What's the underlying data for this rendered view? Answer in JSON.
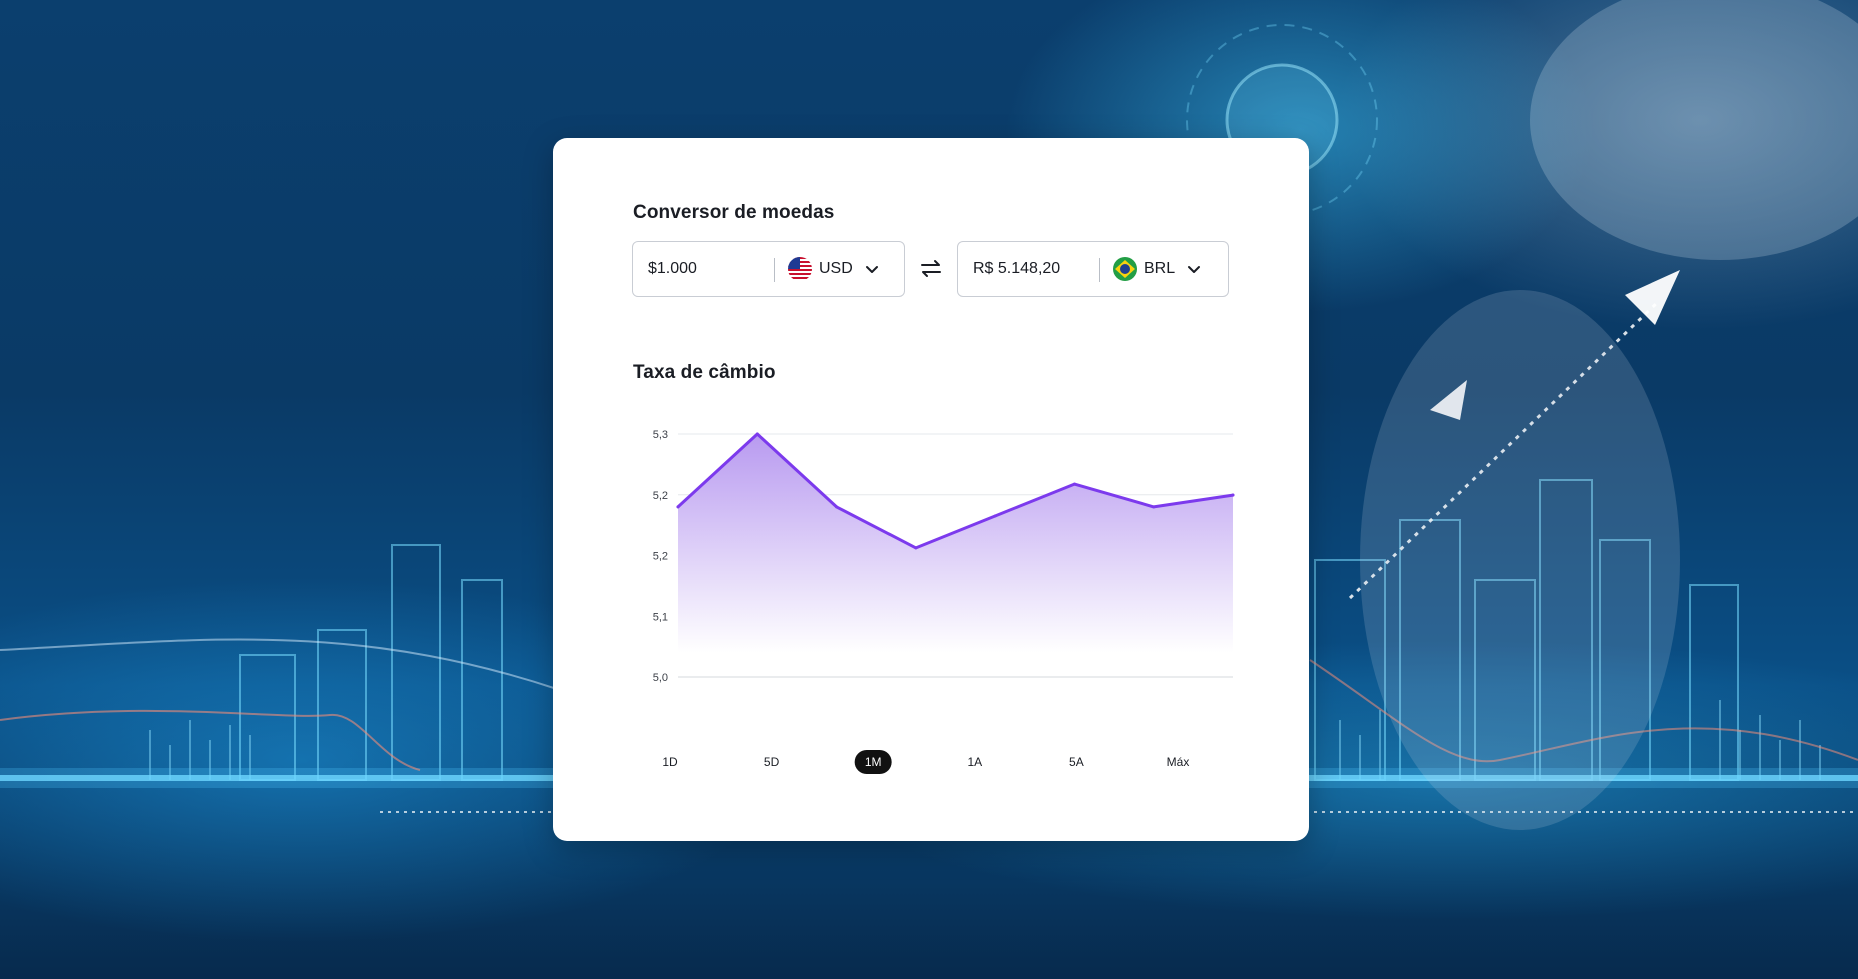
{
  "converter": {
    "title": "Conversor de moedas",
    "from": {
      "amount": "$1.000",
      "currency": "USD",
      "flag": "us-flag-icon"
    },
    "to": {
      "amount": "R$ 5.148,20",
      "currency": "BRL",
      "flag": "brazil-flag-icon"
    },
    "swap_icon": "swap-arrows-icon"
  },
  "exchange": {
    "title": "Taxa de câmbio",
    "ranges": [
      "1D",
      "5D",
      "1M",
      "1A",
      "5A",
      "Máx"
    ],
    "active_range": "1M"
  },
  "chart_data": {
    "type": "area",
    "title": "",
    "xlabel": "",
    "ylabel": "",
    "y_tick_labels": [
      "5,3",
      "5,2",
      "5,2",
      "5,1",
      "5,0"
    ],
    "y_tick_values": [
      5.3,
      5.25,
      5.2,
      5.15,
      5.1
    ],
    "ylim": [
      5.1,
      5.3
    ],
    "x": [
      0,
      1,
      2,
      3,
      4,
      5,
      6,
      7
    ],
    "values": [
      5.22,
      5.3,
      5.22,
      5.175,
      5.21,
      5.245,
      5.22,
      5.233
    ],
    "grid": true,
    "legend": "none",
    "colors": {
      "line": "#7c3aed",
      "fill_top": "#b89af0",
      "fill_bottom": "#ffffff"
    }
  },
  "colors": {
    "accent": "#7c3aed",
    "active_pill": "#111111",
    "card": "#ffffff",
    "text": "#1a1d24"
  }
}
